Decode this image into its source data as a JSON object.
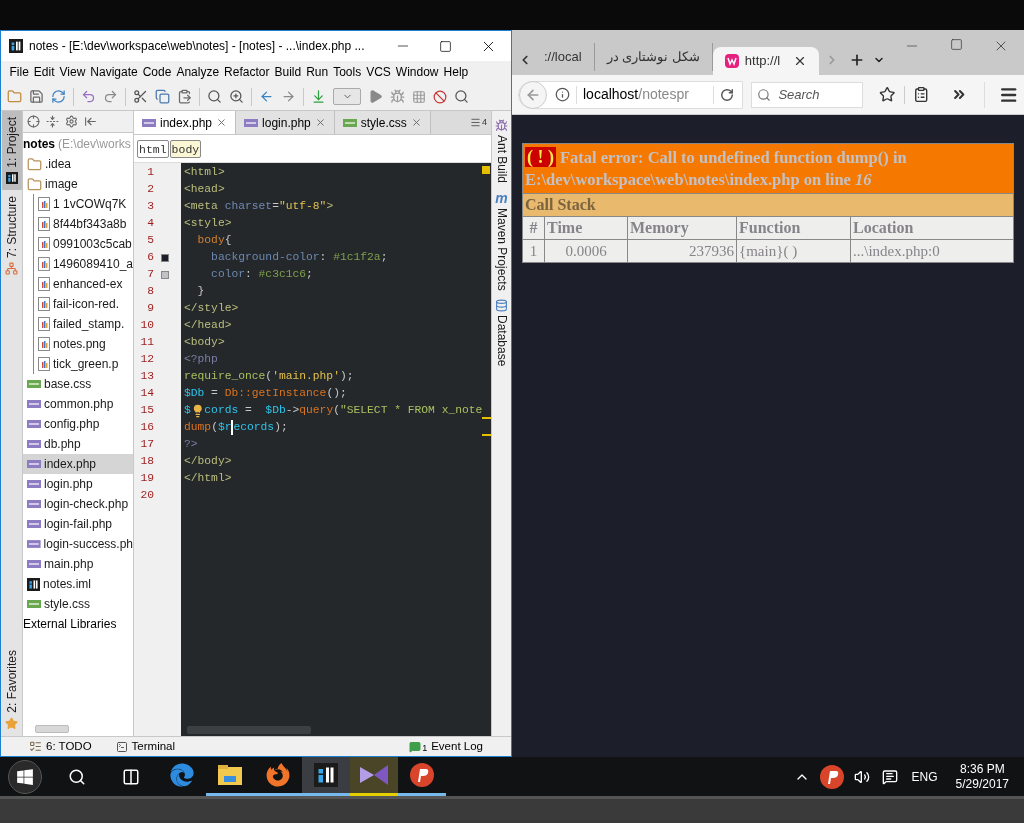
{
  "ide": {
    "title": "notes - [E:\\dev\\workspace\\web\\notes] - [notes] - ...\\index.php ...",
    "menu": [
      "File",
      "Edit",
      "View",
      "Navigate",
      "Code",
      "Analyze",
      "Refactor",
      "Build",
      "Run",
      "Tools",
      "VCS",
      "Window",
      "Help"
    ],
    "left_tool_tabs": [
      {
        "label": "1: Project",
        "kind": "project",
        "selected": true
      },
      {
        "label": "7: Structure",
        "kind": "structure",
        "selected": false
      },
      {
        "label": "2: Favorites",
        "kind": "favorites",
        "selected": false
      }
    ],
    "project_tree": {
      "root": "notes",
      "root_path": "(E:\\dev\\works",
      "items": [
        {
          "label": ".idea",
          "kind": "folder",
          "selected": false
        },
        {
          "label": "image",
          "kind": "folder",
          "selected": false,
          "children": [
            {
              "label": "1 1vCOWq7K",
              "kind": "image",
              "selected": false
            },
            {
              "label": "8f44bf343a8b",
              "kind": "image",
              "selected": false
            },
            {
              "label": "0991003c5cab",
              "kind": "image",
              "selected": false
            },
            {
              "label": "1496089410_a",
              "kind": "image",
              "selected": false
            },
            {
              "label": "enhanced-ex",
              "kind": "image",
              "selected": false
            },
            {
              "label": "fail-icon-red.",
              "kind": "image",
              "selected": false
            },
            {
              "label": "failed_stamp.",
              "kind": "image",
              "selected": false
            },
            {
              "label": "notes.png",
              "kind": "image",
              "selected": false
            },
            {
              "label": "tick_green.p",
              "kind": "image",
              "selected": false
            }
          ]
        },
        {
          "label": "base.css",
          "kind": "css",
          "selected": false
        },
        {
          "label": "common.php",
          "kind": "php",
          "selected": false
        },
        {
          "label": "config.php",
          "kind": "php",
          "selected": false
        },
        {
          "label": "db.php",
          "kind": "php",
          "selected": false
        },
        {
          "label": "index.php",
          "kind": "php",
          "selected": true
        },
        {
          "label": "login.php",
          "kind": "php",
          "selected": false
        },
        {
          "label": "login-check.php",
          "kind": "php",
          "selected": false
        },
        {
          "label": "login-fail.php",
          "kind": "php",
          "selected": false
        },
        {
          "label": "login-success.ph",
          "kind": "php",
          "selected": false
        },
        {
          "label": "main.php",
          "kind": "php",
          "selected": false
        },
        {
          "label": "notes.iml",
          "kind": "iml",
          "selected": false
        },
        {
          "label": "style.css",
          "kind": "css",
          "selected": false
        }
      ],
      "external": "External Libraries"
    },
    "editor_tabs": [
      {
        "label": "index.php",
        "kind": "php",
        "selected": true
      },
      {
        "label": "login.php",
        "kind": "php",
        "selected": false
      },
      {
        "label": "style.css",
        "kind": "css",
        "selected": false
      }
    ],
    "tab_count": "4",
    "breadcrumbs": [
      "html",
      "body"
    ],
    "code_lines": [
      {
        "number": "1",
        "tokens": [
          {
            "kind": "tag",
            "text": "<html>"
          }
        ]
      },
      {
        "number": "2",
        "tokens": [
          {
            "kind": "tag",
            "text": "<head>"
          }
        ]
      },
      {
        "number": "3",
        "tokens": [
          {
            "kind": "tag",
            "text": "<meta "
          },
          {
            "kind": "attr",
            "text": "charset"
          },
          {
            "kind": "punct",
            "text": "="
          },
          {
            "kind": "string",
            "text": "\"utf-8\""
          },
          {
            "kind": "tag",
            "text": ">"
          }
        ]
      },
      {
        "number": "4",
        "tokens": [
          {
            "kind": "tag",
            "text": "<style>"
          }
        ]
      },
      {
        "number": "5",
        "tokens": [
          {
            "kind": "selector",
            "text": "  body"
          },
          {
            "kind": "punct",
            "text": "{"
          }
        ]
      },
      {
        "number": "6",
        "color": "#1c1f2a",
        "tokens": [
          {
            "kind": "property",
            "text": "    background-color"
          },
          {
            "kind": "punct",
            "text": ": "
          },
          {
            "kind": "value",
            "text": "#1c1f2a"
          },
          {
            "kind": "punct",
            "text": ";"
          }
        ]
      },
      {
        "number": "7",
        "color": "#c3c1c6",
        "tokens": [
          {
            "kind": "property",
            "text": "    color"
          },
          {
            "kind": "punct",
            "text": ": "
          },
          {
            "kind": "value",
            "text": "#c3c1c6"
          },
          {
            "kind": "punct",
            "text": ";"
          }
        ]
      },
      {
        "number": "8",
        "tokens": [
          {
            "kind": "punct",
            "text": "  }"
          }
        ]
      },
      {
        "number": "9",
        "tokens": [
          {
            "kind": "tag",
            "text": "</style>"
          }
        ]
      },
      {
        "number": "10",
        "tokens": [
          {
            "kind": "tag",
            "text": "</head>"
          }
        ]
      },
      {
        "number": "11",
        "tokens": [
          {
            "kind": "tag",
            "text": "<body>"
          }
        ]
      },
      {
        "number": "12",
        "tokens": [
          {
            "kind": "php",
            "text": "<?php"
          }
        ]
      },
      {
        "number": "13",
        "tokens": [
          {
            "kind": "func",
            "text": "require_once"
          },
          {
            "kind": "punct",
            "text": "("
          },
          {
            "kind": "string",
            "text": "'main.php'"
          },
          {
            "kind": "punct",
            "text": ");"
          }
        ]
      },
      {
        "number": "14",
        "tokens": [
          {
            "kind": "var",
            "text": "$Db"
          },
          {
            "kind": "punct",
            "text": " = "
          },
          {
            "kind": "method",
            "text": "Db::getInstance"
          },
          {
            "kind": "punct",
            "text": "();"
          }
        ]
      },
      {
        "number": "15",
        "tokens": [
          {
            "kind": "var",
            "text": "$"
          },
          {
            "kind": "bulb"
          },
          {
            "kind": "var",
            "text": "cords"
          },
          {
            "kind": "punct",
            "text": " =  "
          },
          {
            "kind": "var",
            "text": "$Db"
          },
          {
            "kind": "punct",
            "text": "->"
          },
          {
            "kind": "method",
            "text": "query"
          },
          {
            "kind": "punct",
            "text": "("
          },
          {
            "kind": "sql",
            "text": "\"SELECT * FROM x_note"
          }
        ]
      },
      {
        "number": "16",
        "tokens": [
          {
            "kind": "method",
            "text": "dump"
          },
          {
            "kind": "punct",
            "text": "("
          },
          {
            "kind": "var",
            "text": "$r"
          },
          {
            "kind": "caret"
          },
          {
            "kind": "var",
            "text": "ecords"
          },
          {
            "kind": "punct",
            "text": ");"
          }
        ]
      },
      {
        "number": "17",
        "tokens": [
          {
            "kind": "php",
            "text": "?>"
          }
        ]
      },
      {
        "number": "18",
        "tokens": [
          {
            "kind": "tag",
            "text": "</body>"
          }
        ]
      },
      {
        "number": "19",
        "tokens": [
          {
            "kind": "tag",
            "text": "</html>"
          }
        ]
      },
      {
        "number": "20"
      }
    ],
    "right_tool_tabs": [
      {
        "label": "Ant Build",
        "kind": "ant"
      },
      {
        "label": "Maven Projects",
        "kind": "maven",
        "icon": "m"
      },
      {
        "label": "Database",
        "kind": "database"
      }
    ],
    "bottom_tabs": [
      {
        "label": "6: TODO",
        "kind": "todo"
      },
      {
        "label": "Terminal",
        "kind": "terminal"
      }
    ],
    "event_log": {
      "label": "Event Log",
      "count": "1"
    }
  },
  "browser": {
    "tabs": [
      {
        "label": "://local",
        "kind": "page",
        "selected": false
      },
      {
        "label": "شکل نوشتاری در",
        "kind": "page",
        "selected": false
      },
      {
        "label": "http://l",
        "kind": "wamp",
        "selected": true
      }
    ],
    "url_host": "localhost",
    "url_path": "/notespr",
    "search_placeholder": "Search",
    "error": {
      "badge": "( ! )",
      "message": "Fatal error: Call to undefined function dump() in E:\\dev\\workspace\\web\\notes\\index.php on line *16*",
      "call_stack": "Call Stack",
      "columns": [
        "#",
        "Time",
        "Memory",
        "Function",
        "Location"
      ],
      "rows": [
        [
          "1",
          "0.0006",
          "237936",
          "{main}( )",
          "...\\index.php:0"
        ]
      ]
    }
  },
  "taskbar": {
    "apps": [
      {
        "kind": "edge",
        "running": false,
        "selected": false,
        "attention": false
      },
      {
        "kind": "explorer",
        "running": true,
        "selected": false,
        "attention": false
      },
      {
        "kind": "firefox",
        "running": true,
        "selected": false,
        "attention": false
      },
      {
        "kind": "phpstorm",
        "running": true,
        "selected": true,
        "attention": false
      },
      {
        "kind": "studio",
        "running": true,
        "selected": false,
        "attention": true
      },
      {
        "kind": "psiphon",
        "running": true,
        "selected": false,
        "attention": false
      }
    ],
    "language": "ENG",
    "time": "8:36 PM",
    "date": "5/29/2017"
  }
}
